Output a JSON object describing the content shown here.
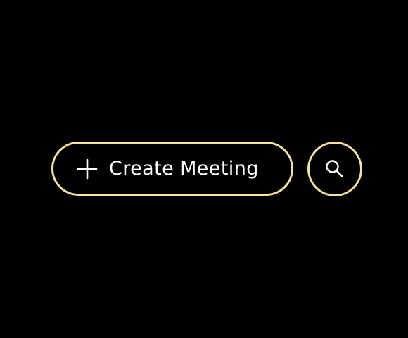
{
  "toolbar": {
    "create_button": {
      "label": "Create Meeting",
      "icon": "plus-icon"
    },
    "search_button": {
      "icon": "search-icon"
    }
  },
  "colors": {
    "background": "#000000",
    "accent_border": "#f4e49a",
    "text": "#ffffff"
  }
}
